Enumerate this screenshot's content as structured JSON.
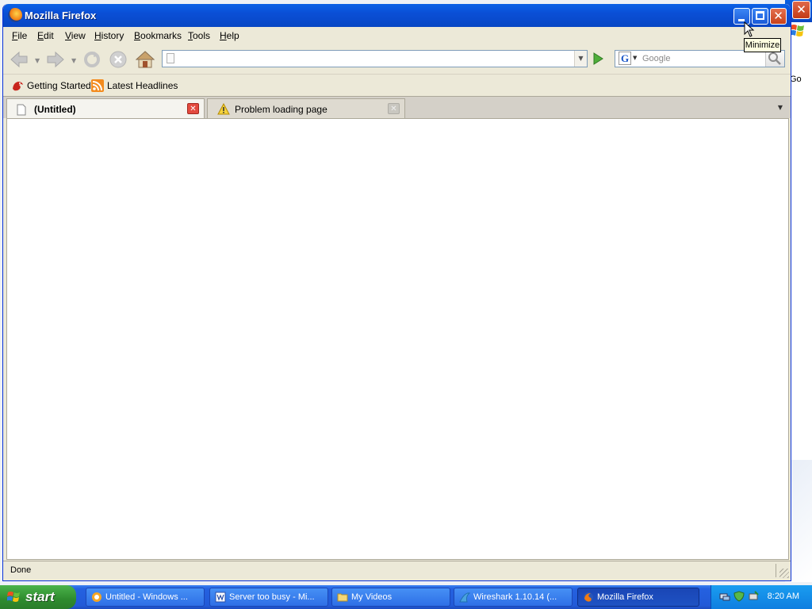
{
  "window": {
    "title": "Mozilla Firefox",
    "caption_close": "✕",
    "tooltip": "Minimize"
  },
  "menu": {
    "items": [
      "File",
      "Edit",
      "View",
      "History",
      "Bookmarks",
      "Tools",
      "Help"
    ]
  },
  "navbar": {
    "url_value": "",
    "search_engine": "G",
    "search_placeholder": "Google"
  },
  "bookmarks": {
    "items": [
      "Getting Started",
      "Latest Headlines"
    ]
  },
  "tabs": [
    {
      "label": "(Untitled)",
      "active": true
    },
    {
      "label": "Problem loading page",
      "active": false
    }
  ],
  "status": {
    "text": "Done"
  },
  "background_window": {
    "close_glyph": "✕",
    "go_text": "Go"
  },
  "taskbar": {
    "start_label": "start",
    "buttons": [
      {
        "label": "Untitled - Windows ...",
        "icon": "windows-live-icon"
      },
      {
        "label": "Server too busy - Mi...",
        "icon": "word-doc-icon"
      },
      {
        "label": "My Videos",
        "icon": "folder-icon"
      },
      {
        "label": "Wireshark 1.10.14 (...",
        "icon": "wireshark-icon"
      },
      {
        "label": "Mozilla Firefox",
        "icon": "firefox-icon",
        "active": true
      }
    ],
    "clock": "8:20 AM"
  },
  "colors": {
    "titlebar": "#0a4fd6",
    "taskbar": "#225ad8",
    "start_button": "#2e8b2e",
    "tab_close_active": "#e34a3f",
    "tray": "#0f7fe0"
  }
}
